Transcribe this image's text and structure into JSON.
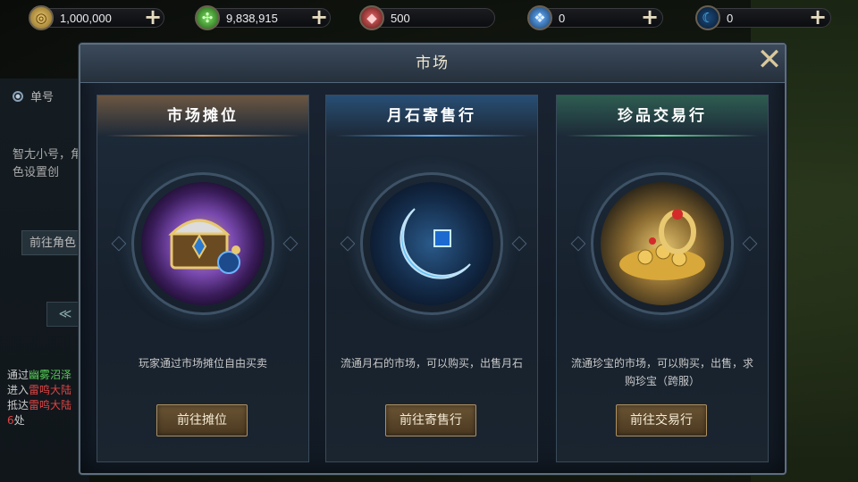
{
  "resources": [
    {
      "icon": "gold-coin-icon",
      "glyph": "◎",
      "value": "1,000,000",
      "color": "#c9a44a"
    },
    {
      "icon": "green-clover-icon",
      "glyph": "✣",
      "value": "9,838,915",
      "color": "#4bbf3c"
    },
    {
      "icon": "red-gem-icon",
      "glyph": "◆",
      "value": "500",
      "color": "#c43a3a"
    },
    {
      "icon": "blue-crystal-icon",
      "glyph": "❖",
      "value": "0",
      "color": "#3a8fe0"
    },
    {
      "icon": "blue-moon-icon",
      "glyph": "☾",
      "value": "0",
      "color": "#2fa4e8"
    }
  ],
  "background": {
    "radio_label": "单号",
    "hint": "智尢小号，角色设置创",
    "goto_label": "前往角色",
    "arrow": "≪",
    "log": {
      "line1_prefix": "通过",
      "line1_place": "幽雾沼泽",
      "line2_prefix": "进入",
      "line2_place": "雷鸣大陆",
      "line3_prefix": "抵达",
      "line3_place": "雷鸣大陆",
      "line4_num": "6",
      "line4_suffix": "处"
    }
  },
  "modal": {
    "title": "市场",
    "close_glyph": "✕",
    "cards": [
      {
        "title": "市场摊位",
        "desc": "玩家通过市场摊位自由买卖",
        "button": "前往摊位",
        "accent": "#c98a4a",
        "icon": "treasure-chest-icon"
      },
      {
        "title": "月石寄售行",
        "desc": "流通月石的市场，可以购买，出售月石",
        "button": "前往寄售行",
        "accent": "#3a8fe0",
        "icon": "moonstone-icon"
      },
      {
        "title": "珍品交易行",
        "desc": "流通珍宝的市场，可以购买，出售，求购珍宝（跨服）",
        "button": "前往交易行",
        "accent": "#4ab87a",
        "icon": "treasure-pile-icon"
      }
    ]
  }
}
